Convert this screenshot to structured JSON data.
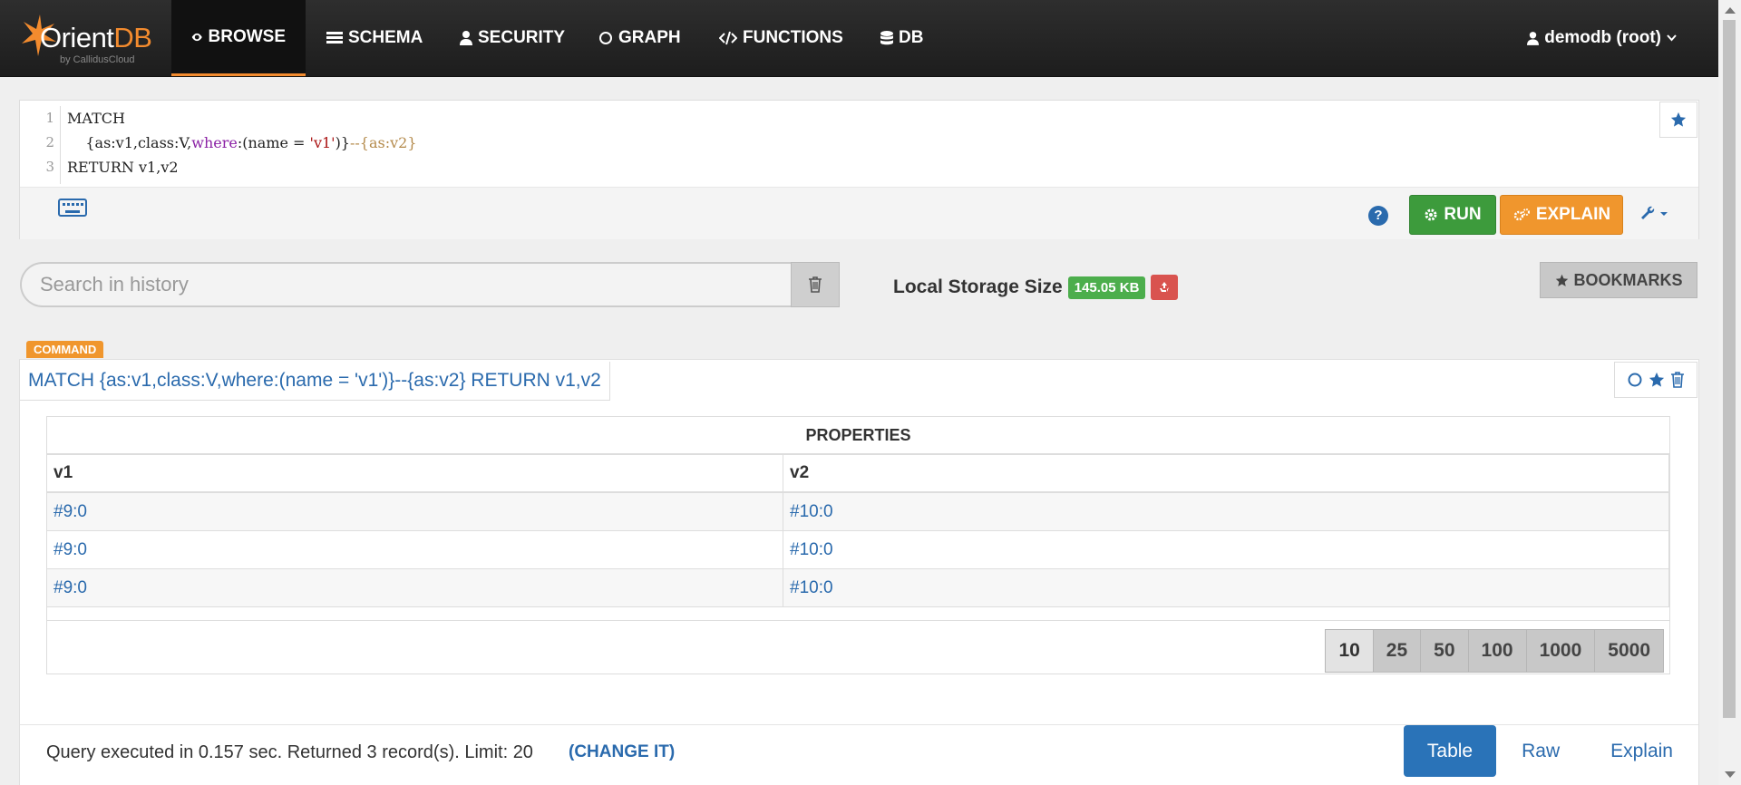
{
  "navbar": {
    "logo_main": "Orient",
    "logo_accent": "DB",
    "logo_sub": "by CallidusCloud",
    "items": [
      {
        "label": "BROWSE",
        "icon": "eye-icon"
      },
      {
        "label": "SCHEMA",
        "icon": "list-icon"
      },
      {
        "label": "SECURITY",
        "icon": "user-icon"
      },
      {
        "label": "GRAPH",
        "icon": "circle-icon"
      },
      {
        "label": "FUNCTIONS",
        "icon": "code-icon"
      },
      {
        "label": "DB",
        "icon": "database-icon"
      }
    ],
    "user": "demodb (root)"
  },
  "editor": {
    "line_numbers": [
      "1",
      "2",
      "3"
    ],
    "line1": "MATCH",
    "line2_a": "    {as:v1,class:V,",
    "line2_kw": "where",
    "line2_b": ":(name = ",
    "line2_str": "'v1'",
    "line2_c": ")}",
    "line2_d": "--{as:v2}",
    "line3": "RETURN v1,v2",
    "run_label": "RUN",
    "explain_label": "EXPLAIN",
    "help_label": "?"
  },
  "history": {
    "search_placeholder": "Search in history",
    "storage_label": "Local Storage Size",
    "storage_size": "145.05 KB",
    "bookmarks_label": "BOOKMARKS"
  },
  "result": {
    "badge": "COMMAND",
    "query": "MATCH {as:v1,class:V,where:(name = 'v1')}--{as:v2} RETURN v1,v2",
    "properties_header": "PROPERTIES",
    "columns": [
      "v1",
      "v2"
    ],
    "rows": [
      [
        "#9:0",
        "#10:0"
      ],
      [
        "#9:0",
        "#10:0"
      ],
      [
        "#9:0",
        "#10:0"
      ]
    ],
    "page_sizes": [
      "10",
      "25",
      "50",
      "100",
      "1000",
      "5000"
    ],
    "selected_page_size": "10",
    "exec_info": "Query executed in 0.157 sec. Returned 3 record(s). Limit: 20",
    "change_it": "(CHANGE IT)",
    "view_tabs": [
      "Table",
      "Raw",
      "Explain"
    ],
    "selected_view": "Table"
  },
  "colors": {
    "accent_orange": "#f0962d",
    "run_green": "#3d9b3c",
    "link_blue": "#2a6aad",
    "navbar_bg": "#1f1f1f"
  }
}
